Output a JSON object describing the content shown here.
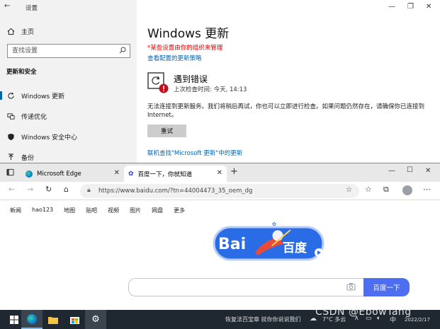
{
  "settings": {
    "window_title": "设置",
    "sidebar": {
      "home": "主页",
      "search_placeholder": "查找设置",
      "section": "更新和安全",
      "items": [
        {
          "label": "Windows 更新"
        },
        {
          "label": "传递优化"
        },
        {
          "label": "Windows 安全中心"
        },
        {
          "label": "备份"
        }
      ]
    },
    "main": {
      "title": "Windows 更新",
      "managed_note": "*某些设置由你的组织来管理",
      "view_policy": "查看配置的更新策略",
      "error_title": "遇到错误",
      "last_check": "上次检查时间: 今天, 14:13",
      "error_desc": "无法连接到更新服务。我们将稍后再试，你也可以立即进行检查。如果问题仍然存在，请确保你已连接到 Internet。",
      "retry_label": "重试",
      "online_link": "联机查找\"Microsoft 更新\"中的更新"
    }
  },
  "edge": {
    "tabs": [
      {
        "label": "Microsoft Edge"
      },
      {
        "label": "百度一下，你就知道"
      }
    ],
    "url": "https://www.baidu.com/?tn=44004473_35_oem_dg",
    "nav_links": [
      "新闻",
      "hao123",
      "地图",
      "贴吧",
      "视频",
      "图片",
      "网盘",
      "更多"
    ],
    "logo_text": "Bai",
    "logo_cn": "百度",
    "search_button": "百度一下"
  },
  "taskbar": {
    "tray_text": "恢复法百宝章 就你你说说我们",
    "tray_right": "7°C 多云",
    "date": "2022/2/17"
  },
  "watermark": "CSDN @EbowTang",
  "colors": {
    "accent": "#0063b1",
    "baidu_blue": "#4e6ef2",
    "warning_red": "#e00000",
    "taskbar": "#1f2730"
  }
}
